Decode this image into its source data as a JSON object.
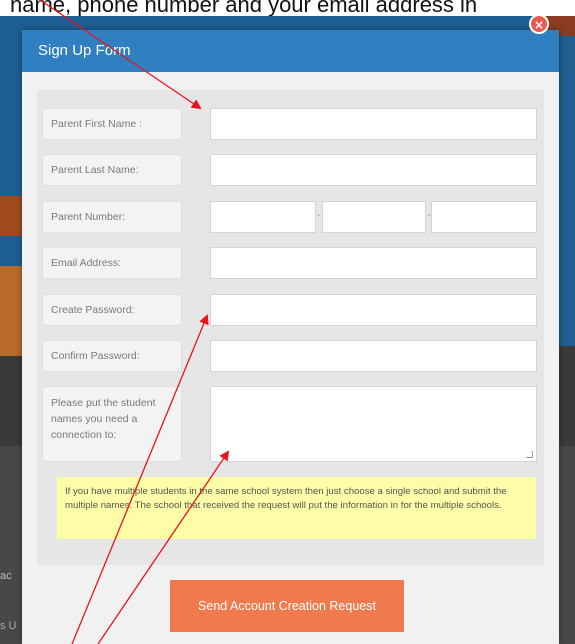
{
  "caption": "name, phone number and your email address in",
  "form": {
    "title": "Sign Up Form",
    "close_glyph": "×",
    "fields": {
      "first_name_label": "Parent First Name :",
      "last_name_label": "Parent Last Name:",
      "phone_label": "Parent Number:",
      "email_label": "Email Address:",
      "password_label": "Create Password:",
      "confirm_label": "Confirm Password:",
      "students_label": "Please put the student names you need a connection to:"
    },
    "phone_separator": "-",
    "notice": "If you have multiple students in the same school system then just choose a single school and submit the multiple names. The school that received the request will put the information in for the multiple schools.",
    "submit_label": "Send Account Creation Request"
  },
  "background": {
    "left_text_1": "ac",
    "left_text_2": "s U"
  },
  "colors": {
    "header": "#2f7fc1",
    "submit": "#ef7a4e",
    "notice_bg": "#fdfda7",
    "annotation": "#e8141c"
  }
}
